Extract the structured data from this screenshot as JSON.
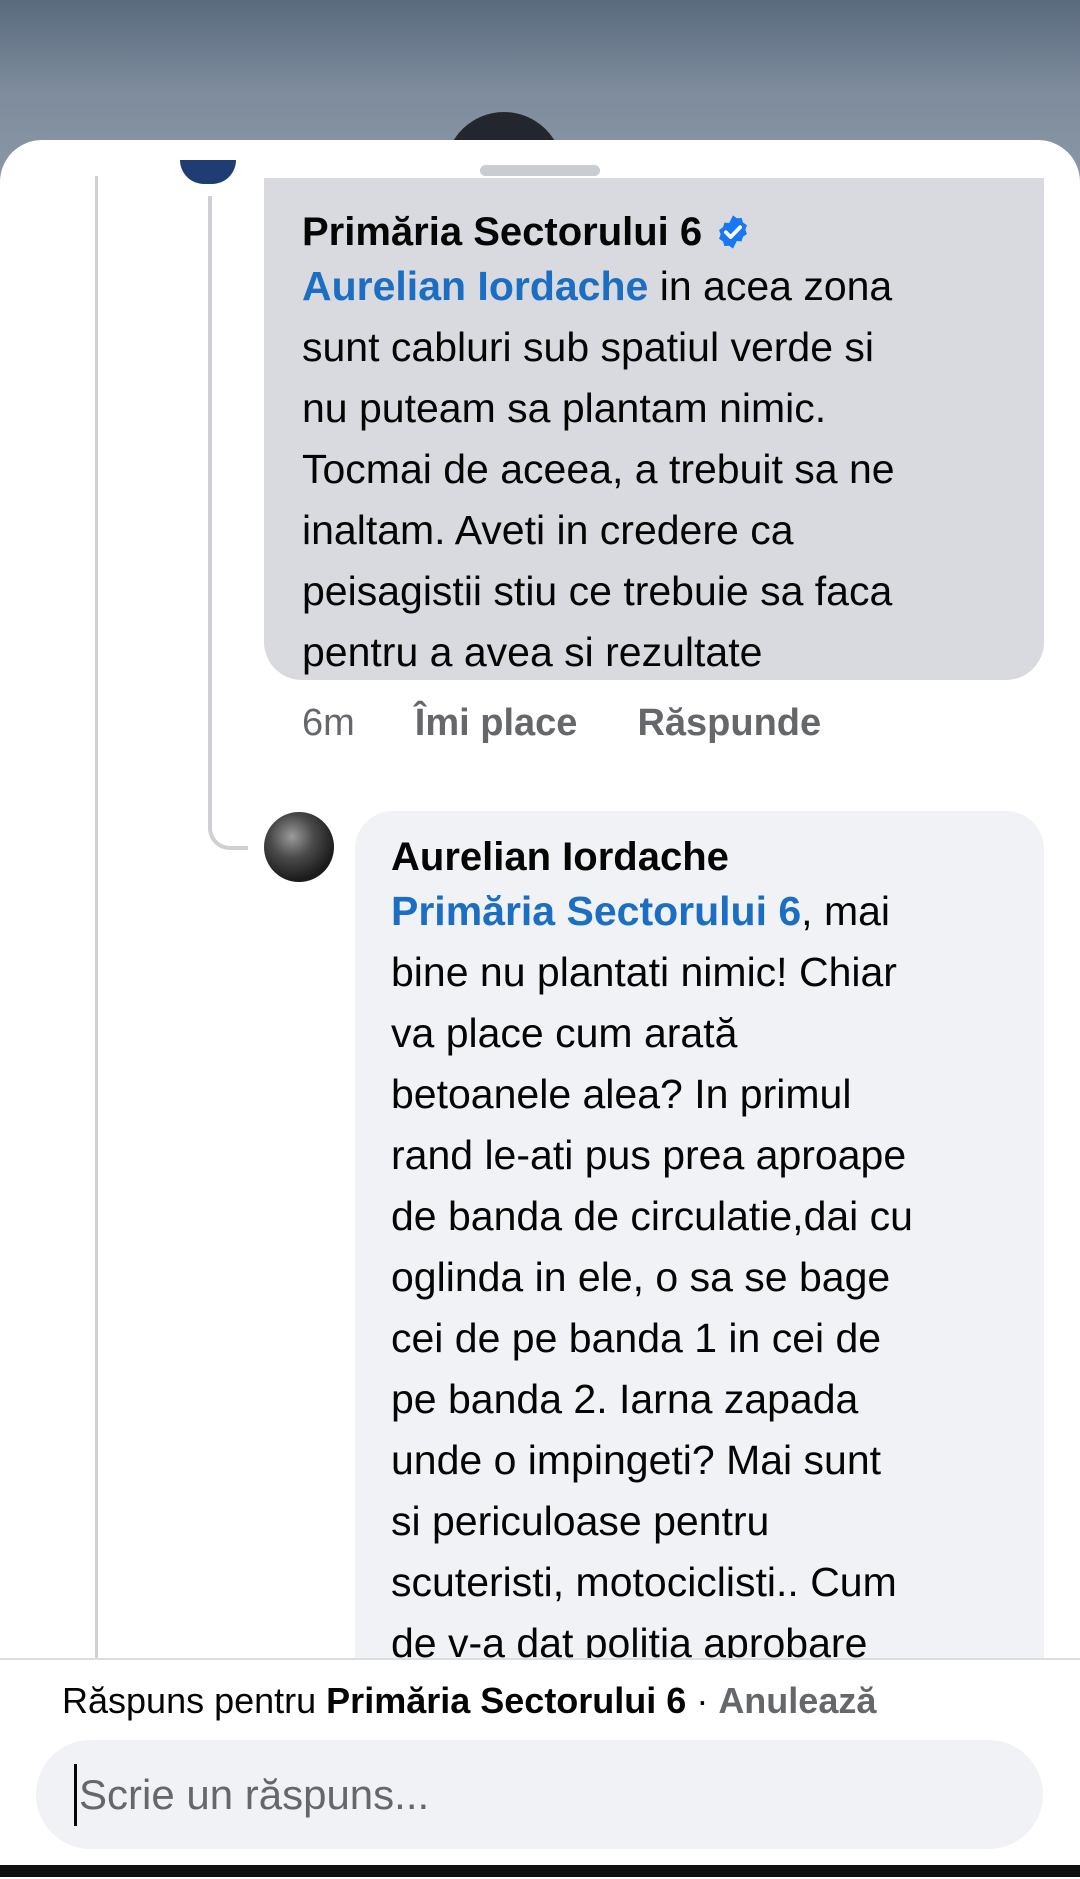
{
  "comment_main": {
    "author": "Primăria Sectorului 6",
    "verified_icon": "verified-badge-icon",
    "mention": "Aurelian Iordache",
    "text": " in acea zona\nsunt cabluri sub spatiul verde si\nnu puteam sa plantam nimic.\nTocmai de aceea, a trebuit sa ne\ninaltam. Aveti in credere ca\npeisagistii stiu ce trebuie sa faca\npentru a avea si rezultate",
    "time": "6m",
    "like_label": "Îmi place",
    "reply_label": "Răspunde"
  },
  "comment_reply": {
    "author": "Aurelian Iordache",
    "mention": "Primăria Sectorului 6",
    "text": ", mai\nbine nu plantati nimic! Chiar\nva place cum arată\nbetoanele alea? In primul\nrand le-ati pus prea aproape\nde banda de circulatie,dai cu\noglinda in ele, o sa se bage\ncei de pe banda 1 in cei de\npe banda 2. Iarna zapada\nunde o impingeti? Mai sunt\nsi periculoase pentru\nscuteristi, motociclisti.. Cum\nde v-a dat politia aprobare"
  },
  "composer": {
    "reply_prefix": "Răspuns pentru ",
    "reply_target": "Primăria Sectorului 6",
    "separator": " · ",
    "cancel_label": "Anulează",
    "placeholder": "Scrie un răspuns..."
  },
  "colors": {
    "mention": "#1b6ec2",
    "verified": "#1877f2",
    "bubble_main": "#d8dadf",
    "bubble_reply": "#f0f2f5"
  }
}
